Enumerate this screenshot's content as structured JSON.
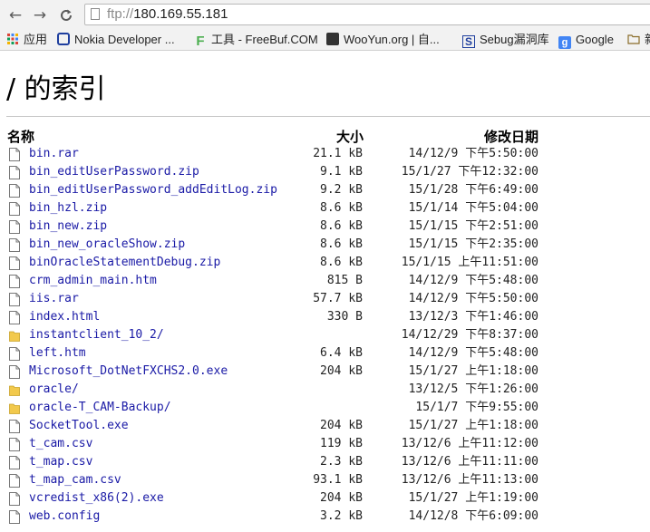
{
  "browser": {
    "url_scheme": "ftp://",
    "url_host": "180.169.55.181",
    "nav_back": "←",
    "nav_forward": "→",
    "nav_reload": "C"
  },
  "bookmarks": [
    {
      "label": "应用",
      "icon": "apps-grid-icon"
    },
    {
      "label": "Nokia Developer ...",
      "icon": "nokia-icon"
    },
    {
      "label": "工具 - FreeBuf.COM",
      "icon": "freebuf-icon"
    },
    {
      "label": "WooYun.org | 自...",
      "icon": "wooyun-icon"
    },
    {
      "label": "Sebug漏洞库",
      "icon": "sebug-icon"
    },
    {
      "label": "Google",
      "icon": "google-icon"
    },
    {
      "label": "新",
      "icon": "folder-icon"
    }
  ],
  "listing": {
    "title": "/ 的索引",
    "col_name": "名称",
    "col_size": "大小",
    "col_date": "修改日期",
    "rows": [
      {
        "name": "bin.rar",
        "size": "21.1 kB",
        "date": "14/12/9 下午5:50:00",
        "type": "file"
      },
      {
        "name": "bin_editUserPassword.zip",
        "size": "9.1 kB",
        "date": "15/1/27 下午12:32:00",
        "type": "file"
      },
      {
        "name": "bin_editUserPassword_addEditLog.zip",
        "size": "9.2 kB",
        "date": "15/1/28 下午6:49:00",
        "type": "file"
      },
      {
        "name": "bin_hzl.zip",
        "size": "8.6 kB",
        "date": "15/1/14 下午5:04:00",
        "type": "file"
      },
      {
        "name": "bin_new.zip",
        "size": "8.6 kB",
        "date": "15/1/15 下午2:51:00",
        "type": "file"
      },
      {
        "name": "bin_new_oracleShow.zip",
        "size": "8.6 kB",
        "date": "15/1/15 下午2:35:00",
        "type": "file"
      },
      {
        "name": "binOracleStatementDebug.zip",
        "size": "8.6 kB",
        "date": "15/1/15 上午11:51:00",
        "type": "file"
      },
      {
        "name": "crm_admin_main.htm",
        "size": "815 B",
        "date": "14/12/9 下午5:48:00",
        "type": "file"
      },
      {
        "name": "iis.rar",
        "size": "57.7 kB",
        "date": "14/12/9 下午5:50:00",
        "type": "file"
      },
      {
        "name": "index.html",
        "size": "330 B",
        "date": "13/12/3 下午1:46:00",
        "type": "file"
      },
      {
        "name": "instantclient_10_2/",
        "size": "",
        "date": "14/12/29 下午8:37:00",
        "type": "folder"
      },
      {
        "name": "left.htm",
        "size": "6.4 kB",
        "date": "14/12/9 下午5:48:00",
        "type": "file"
      },
      {
        "name": "Microsoft_DotNetFXCHS2.0.exe",
        "size": "204 kB",
        "date": "15/1/27 上午1:18:00",
        "type": "file"
      },
      {
        "name": "oracle/",
        "size": "",
        "date": "13/12/5 下午1:26:00",
        "type": "folder"
      },
      {
        "name": "oracle-T_CAM-Backup/",
        "size": "",
        "date": "15/1/7 下午9:55:00",
        "type": "folder"
      },
      {
        "name": "SocketTool.exe",
        "size": "204 kB",
        "date": "15/1/27 上午1:18:00",
        "type": "file"
      },
      {
        "name": "t_cam.csv",
        "size": "119 kB",
        "date": "13/12/6 上午11:12:00",
        "type": "file"
      },
      {
        "name": "t_map.csv",
        "size": "2.3 kB",
        "date": "13/12/6 上午11:11:00",
        "type": "file"
      },
      {
        "name": "t_map_cam.csv",
        "size": "93.1 kB",
        "date": "13/12/6 上午11:13:00",
        "type": "file"
      },
      {
        "name": "vcredist_x86(2).exe",
        "size": "204 kB",
        "date": "15/1/27 上午1:19:00",
        "type": "file"
      },
      {
        "name": "web.config",
        "size": "3.2 kB",
        "date": "14/12/8 下午6:09:00",
        "type": "file"
      }
    ]
  },
  "colors": {
    "link": "#1a1aa6",
    "folder": "#f2c94c",
    "chrome_bg": "#f2f2f2"
  }
}
